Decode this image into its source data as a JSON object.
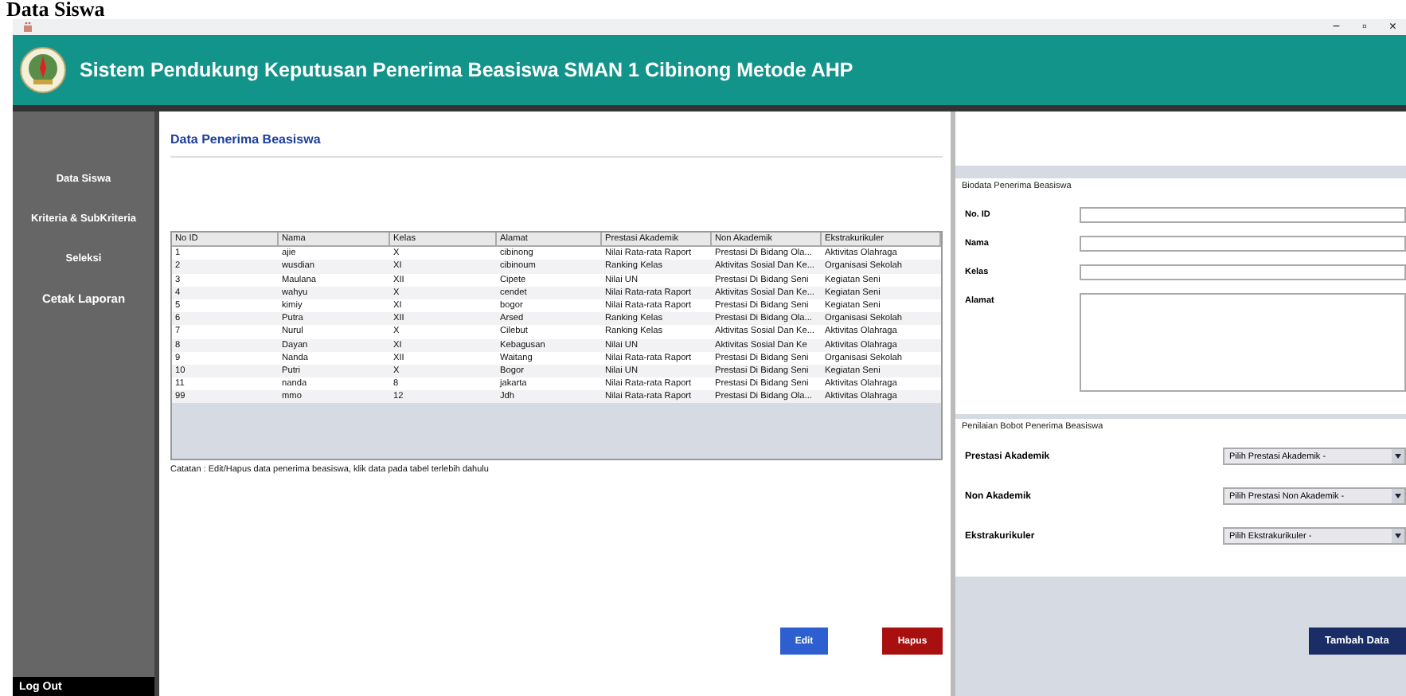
{
  "caption": "Data Siswa",
  "window": {
    "title": "Sistem Pendukung Keputusan Penerima Beasiswa SMAN 1 Cibinong Metode AHP",
    "controls": [
      "−",
      "▫",
      "×"
    ]
  },
  "sidebar": {
    "items": [
      "Data Siswa",
      "Kriteria & SubKriteria",
      "Seleksi",
      "Cetak Laporan"
    ],
    "logout": "Log Out"
  },
  "main": {
    "title": "Data Penerima Beasiswa",
    "table": {
      "columns": [
        "No ID",
        "Nama",
        "Kelas",
        "Alamat",
        "Prestasi Akademik",
        "Non Akademik",
        "Ekstrakurikuler"
      ],
      "rows": [
        [
          "1",
          "ajie",
          "X",
          "cibinong",
          "Nilai Rata-rata Raport",
          "Prestasi Di Bidang Ola...",
          "Aktivitas Olahraga"
        ],
        [
          "2",
          "wusdian",
          "XI",
          "cibinoum",
          "Ranking Kelas",
          "Aktivitas Sosial Dan Ke...",
          "Organisasi Sekolah"
        ],
        [
          "3",
          "Maulana",
          "XII",
          "Cipete",
          "Nilai UN",
          "Prestasi Di Bidang Seni",
          "Kegiatan Seni"
        ],
        [
          "4",
          "wahyu",
          "X",
          "cendet",
          "Nilai Rata-rata Raport",
          "Aktivitas Sosial Dan Ke...",
          "Kegiatan Seni"
        ],
        [
          "5",
          "kimiy",
          "XI",
          "bogor",
          "Nilai Rata-rata Raport",
          "Prestasi Di Bidang Seni",
          "Kegiatan Seni"
        ],
        [
          "6",
          "Putra",
          "XII",
          "Arsed",
          "Ranking Kelas",
          "Prestasi Di Bidang Ola...",
          "Organisasi Sekolah"
        ],
        [
          "7",
          "Nurul",
          "X",
          "Cilebut",
          "Ranking Kelas",
          "Aktivitas Sosial Dan Ke...",
          "Aktivitas Olahraga"
        ],
        [
          "8",
          "Dayan",
          "XI",
          "Kebagusan",
          "Nilai UN",
          "Aktivitas Sosial Dan Ke",
          "Aktivitas Olahraga"
        ],
        [
          "9",
          "Nanda",
          "XII",
          "Waitang",
          "Nilai Rata-rata Raport",
          "Prestasi Di Bidang Seni",
          "Organisasi Sekolah"
        ],
        [
          "10",
          "Putri",
          "X",
          "Bogor",
          "Nilai UN",
          "Prestasi Di Bidang Seni",
          "Kegiatan Seni"
        ],
        [
          "11",
          "nanda",
          "8",
          "jakarta",
          "Nilai Rata-rata Raport",
          "Prestasi Di Bidang Seni",
          "Aktivitas Olahraga"
        ],
        [
          "99",
          "mmo",
          "12",
          "Jdh",
          "Nilai Rata-rata Raport",
          "Prestasi Di Bidang Ola...",
          "Aktivitas Olahraga"
        ]
      ]
    },
    "note": "Catatan : Edit/Hapus data penerima beasiswa, klik data pada tabel terlebih dahulu",
    "buttons": [
      {
        "label": "Edit",
        "kind": "edit"
      },
      {
        "label": "Hapus",
        "kind": "delete"
      }
    ]
  },
  "biodata": {
    "title": "Biodata Penerima Beasiswa",
    "fields": [
      {
        "label": "No. ID",
        "kind": "line"
      },
      {
        "label": "Nama",
        "kind": "line"
      },
      {
        "label": "Kelas",
        "kind": "line"
      },
      {
        "label": "Alamat",
        "kind": "area"
      }
    ]
  },
  "bobot": {
    "title": "Penilaian Bobot Penerima Beasiswa",
    "selects": [
      {
        "label": "Prestasi Akademik",
        "value": "Pilih Prestasi Akademik -"
      },
      {
        "label": "Non Akademik",
        "value": "Pilih Prestasi Non Akademik -"
      },
      {
        "label": "Ekstrakurikuler",
        "value": "Pilih Ekstrakurikuler -"
      }
    ]
  },
  "add_button": "Tambah Data"
}
